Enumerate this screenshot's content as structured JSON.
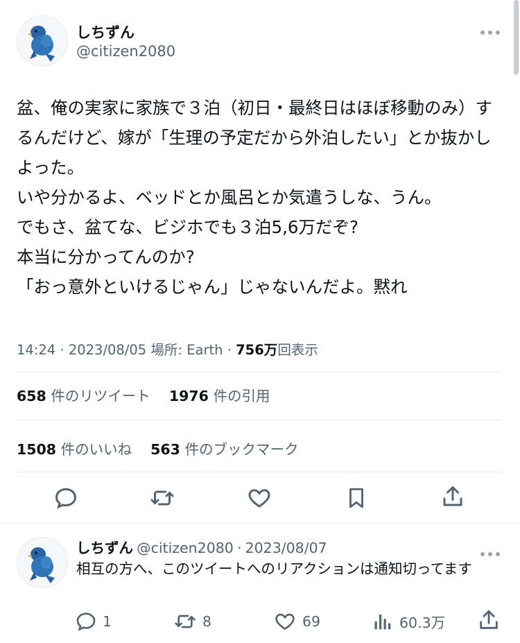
{
  "tweet": {
    "author": {
      "name": "しちずん",
      "handle": "@citizen2080"
    },
    "more_icon": "ellipsis-icon",
    "text": "盆、俺の実家に家族で３泊（初日・最終日はほぼ移動のみ）するんだけど、嫁が「生理の予定だから外泊したい」とか抜かしよった。\nいや分かるよ、ベッドとか風呂とか気遣うしな、うん。\nでもさ、盆てな、ビジホでも３泊5,6万だぞ?\n本当に分かってんのか?\n「おっ意外といけるじゃん」じゃないんだよ。黙れ",
    "time": "14:24",
    "date": "2023/08/05",
    "location_label": "場所: Earth",
    "views_count": "756万",
    "views_label": "回表示",
    "retweets_count": "658",
    "retweets_label": "件のリツイート",
    "quotes_count": "1976",
    "quotes_label": "件の引用",
    "likes_count": "1508",
    "likes_label": "件のいいね",
    "bookmarks_count": "563",
    "bookmarks_label": "件のブックマーク",
    "actions": [
      "reply-icon",
      "retweet-icon",
      "like-icon",
      "bookmark-icon",
      "share-icon"
    ]
  },
  "reply": {
    "author": {
      "name": "しちずん",
      "handle": "@citizen2080",
      "date": "2023/08/07"
    },
    "separator": "·",
    "text": "相互の方へ、このツイートへのリアクションは通知切ってます",
    "reply_count": "1",
    "retweet_count": "8",
    "like_count": "69",
    "views_count": "60.3万"
  },
  "colors": {
    "text": "#0f1419",
    "secondary": "#536471",
    "divider": "#e5e8eb",
    "avatar_bird": "#2f6fb3"
  }
}
